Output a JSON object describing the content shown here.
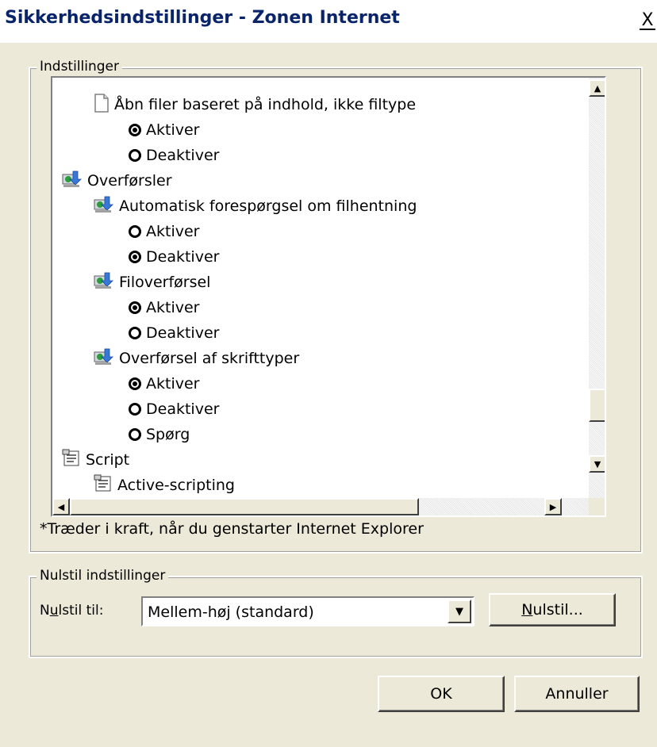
{
  "window": {
    "title": "Sikkerhedsindstillinger - Zonen Internet",
    "close_glyph": "X"
  },
  "settings": {
    "group_label": "Indstillinger",
    "items": [
      {
        "kind": "leaf",
        "icon": "document-icon",
        "label": "Åbn filer baseret på indhold, ikke filtype"
      },
      {
        "kind": "radio",
        "checked": true,
        "label": "Aktiver"
      },
      {
        "kind": "radio",
        "checked": false,
        "label": "Deaktiver"
      },
      {
        "kind": "category",
        "icon": "download-icon",
        "label": "Overførsler"
      },
      {
        "kind": "leaf",
        "icon": "download-icon",
        "label": "Automatisk forespørgsel om filhentning"
      },
      {
        "kind": "radio",
        "checked": false,
        "label": "Aktiver"
      },
      {
        "kind": "radio",
        "checked": true,
        "label": "Deaktiver"
      },
      {
        "kind": "leaf",
        "icon": "download-icon",
        "label": "Filoverførsel"
      },
      {
        "kind": "radio",
        "checked": true,
        "label": "Aktiver"
      },
      {
        "kind": "radio",
        "checked": false,
        "label": "Deaktiver"
      },
      {
        "kind": "leaf",
        "icon": "download-icon",
        "label": "Overførsel af skrifttyper"
      },
      {
        "kind": "radio",
        "checked": true,
        "label": "Aktiver"
      },
      {
        "kind": "radio",
        "checked": false,
        "label": "Deaktiver"
      },
      {
        "kind": "radio",
        "checked": false,
        "label": "Spørg"
      },
      {
        "kind": "category",
        "icon": "script-icon",
        "label": "Script"
      },
      {
        "kind": "leaf",
        "icon": "script-icon",
        "label": "Active-scripting"
      }
    ],
    "note": "*Træder i kraft, når du genstarter Internet Explorer"
  },
  "reset": {
    "group_label": "Nulstil indstillinger",
    "reset_to_label_pre": "N",
    "reset_to_label_acc": "u",
    "reset_to_label_post": "lstil til:",
    "selected": "Mellem-høj (standard)",
    "reset_button_acc": "N",
    "reset_button_post": "ulstil..."
  },
  "buttons": {
    "ok": "OK",
    "cancel": "Annuller"
  },
  "colors": {
    "dialog_bg": "#ece9d8",
    "title_text": "#0a246a",
    "list_bg": "#ffffff"
  }
}
